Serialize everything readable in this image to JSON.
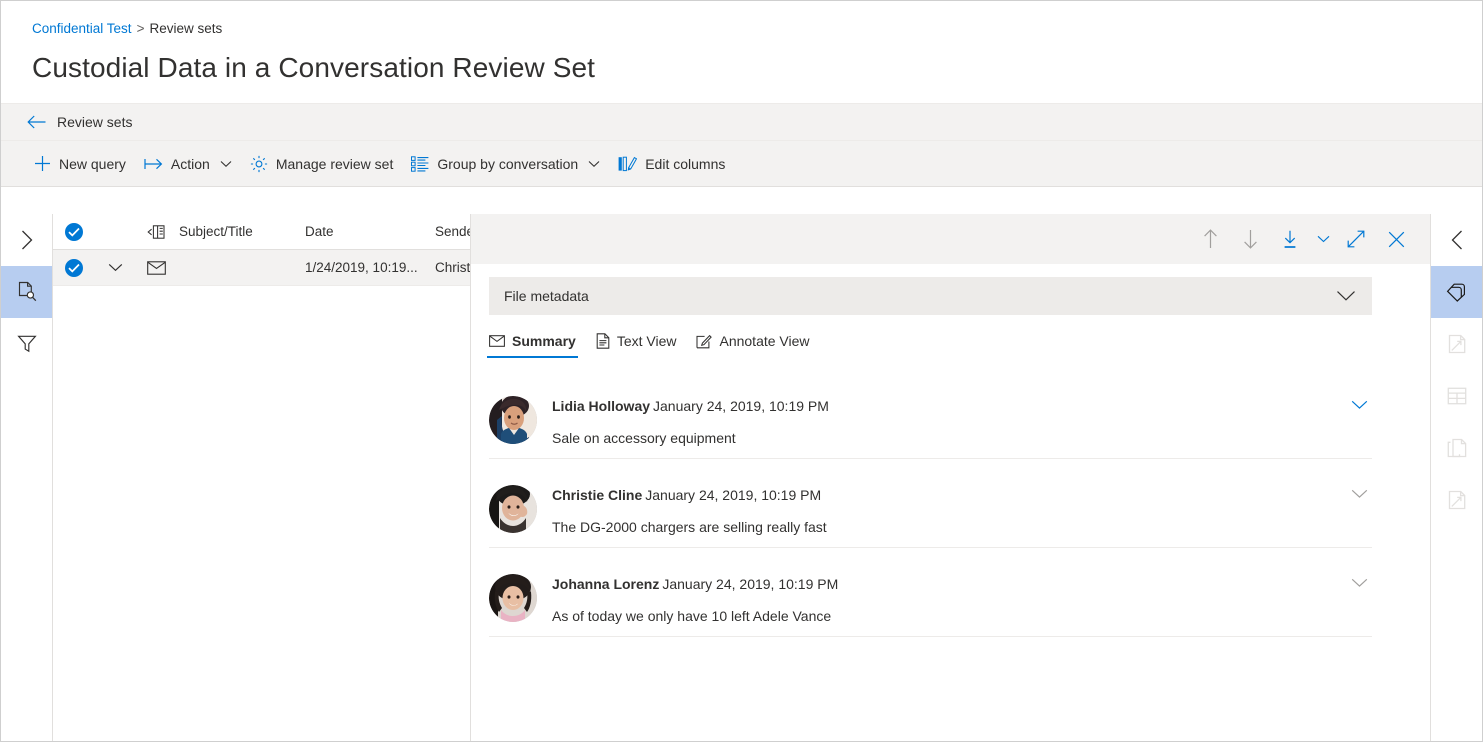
{
  "header": {
    "breadcrumb": {
      "root": "Confidential Test",
      "separator": ">",
      "current": "Review sets"
    },
    "title": "Custodial Data in a Conversation Review Set"
  },
  "backbar": {
    "label": "Review sets",
    "icon": "arrow-left-icon"
  },
  "commandbar": {
    "items": [
      {
        "label": "New query",
        "icon": "plus-icon",
        "has_caret": false
      },
      {
        "label": "Action",
        "icon": "action-arrow-icon",
        "has_caret": true
      },
      {
        "label": "Manage review set",
        "icon": "gear-icon",
        "has_caret": false
      },
      {
        "label": "Group by conversation",
        "icon": "group-list-icon",
        "has_caret": true
      },
      {
        "label": "Edit columns",
        "icon": "edit-columns-icon",
        "has_caret": false
      }
    ]
  },
  "left_rail": {
    "items": [
      {
        "name": "expand-nav",
        "icon": "chevron-right-icon",
        "active": false,
        "disabled": false
      },
      {
        "name": "document-search",
        "icon": "document-search-icon",
        "active": true,
        "disabled": false
      },
      {
        "name": "filters",
        "icon": "filter-funnel-icon",
        "active": false,
        "disabled": false
      }
    ]
  },
  "right_rail": {
    "items": [
      {
        "name": "collapse-panel",
        "icon": "chevron-left-icon",
        "active": false,
        "disabled": false
      },
      {
        "name": "tags",
        "icon": "tag-icon",
        "active": true,
        "disabled": false
      },
      {
        "name": "near-duplicates",
        "icon": "page-arrow-icon",
        "active": false,
        "disabled": true
      },
      {
        "name": "email-threads",
        "icon": "table-grid-icon",
        "active": false,
        "disabled": true
      },
      {
        "name": "duplicates",
        "icon": "copy-stack-icon",
        "active": false,
        "disabled": true
      },
      {
        "name": "themes",
        "icon": "page-arrow-icon",
        "active": false,
        "disabled": true
      }
    ]
  },
  "list": {
    "columns": [
      {
        "key": "check",
        "label": "",
        "icon": "checkmark-circle-icon"
      },
      {
        "key": "expand",
        "label": "",
        "icon": ""
      },
      {
        "key": "attach",
        "label": "",
        "icon": "collapse-panel-icon"
      },
      {
        "key": "subject",
        "label": "Subject/Title"
      },
      {
        "key": "date",
        "label": "Date"
      },
      {
        "key": "sender",
        "label": "Sender"
      }
    ],
    "rows": [
      {
        "selected": true,
        "expand_icon": "chevron-down-icon",
        "type_icon": "envelope-icon",
        "subject": "",
        "date": "1/24/2019, 10:19...",
        "sender": "Christie"
      }
    ]
  },
  "detail": {
    "toolbar": [
      {
        "name": "previous-item",
        "icon": "arrow-up-icon",
        "disabled": true
      },
      {
        "name": "next-item",
        "icon": "arrow-down-icon",
        "disabled": true
      },
      {
        "name": "download",
        "icon": "download-icon",
        "disabled": false
      },
      {
        "name": "download-options",
        "icon": "chevron-down-icon",
        "disabled": false
      },
      {
        "name": "expand-view",
        "icon": "expand-diagonal-icon",
        "disabled": false
      },
      {
        "name": "close-panel",
        "icon": "close-icon",
        "disabled": false
      }
    ],
    "metadata": {
      "label": "File metadata",
      "collapse_icon": "chevron-down-icon",
      "expanded": false
    },
    "tabs": [
      {
        "label": "Summary",
        "icon": "envelope-icon",
        "selected": true
      },
      {
        "label": "Text View",
        "icon": "document-text-icon",
        "selected": false
      },
      {
        "label": "Annotate View",
        "icon": "annotate-pen-icon",
        "selected": false
      }
    ],
    "messages": [
      {
        "sender": "Lidia Holloway",
        "time": "January 24, 2019, 10:19 PM",
        "text": "Sale on accessory equipment",
        "avatar_colors": [
          "#2b2b3a",
          "#d9a183",
          "#1f4e79"
        ],
        "chevron": "chevron-down-icon"
      },
      {
        "sender": "Christie Cline",
        "time": "January 24, 2019, 10:19 PM",
        "text": "The DG-2000 chargers are selling really fast",
        "avatar_colors": [
          "#1d1b1a",
          "#e0b49a",
          "#3a3330"
        ],
        "chevron": "chevron-down-icon"
      },
      {
        "sender": "Johanna Lorenz",
        "time": "January 24, 2019, 10:19 PM",
        "text": "As of today we only have 10 left Adele Vance",
        "avatar_colors": [
          "#221c1a",
          "#e8bfa4",
          "#e9b3c4"
        ],
        "chevron": "chevron-down-icon"
      }
    ]
  },
  "colors": {
    "accent": "#0078d4",
    "chrome": "#f3f2f1",
    "metadata_bar": "#edebe9",
    "rail_active": "#b7cdf0",
    "row_selected": "#f3f2f1",
    "text": "#323130",
    "muted": "#605e5c",
    "disabled": "#a19f9d"
  }
}
